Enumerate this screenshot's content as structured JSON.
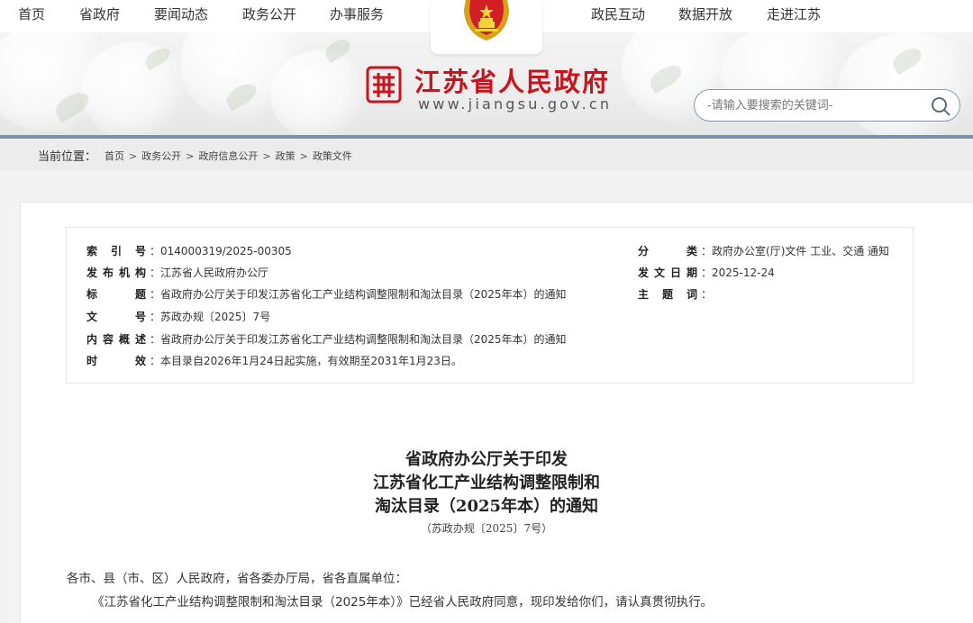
{
  "nav": {
    "items": [
      "首页",
      "省政府",
      "要闻动态",
      "政务公开",
      "办事服务",
      "政民互动",
      "数据开放",
      "走进江苏"
    ]
  },
  "header": {
    "title": "江苏省人民政府",
    "url": "www.jiangsu.gov.cn",
    "logo_icon": "jiangsu-gov-logo-icon",
    "emblem_icon": "national-emblem-icon",
    "brand_color": "#c8151d"
  },
  "search": {
    "placeholder": "-请输入要搜索的关键词-",
    "icon": "search-icon"
  },
  "breadcrumb": {
    "label": "当前位置：",
    "items": [
      "首页",
      "政务公开",
      "政府信息公开",
      "政策",
      "政策文件"
    ]
  },
  "meta": {
    "left": [
      {
        "key": "索引号",
        "value": "014000319/2025-00305"
      },
      {
        "key": "发布机构",
        "value": "江苏省人民政府办公厅"
      },
      {
        "key": "标题",
        "value": "省政府办公厅关于印发江苏省化工产业结构调整限制和淘汰目录（2025年本）的通知"
      },
      {
        "key": "文号",
        "value": "苏政办规〔2025〕7号"
      },
      {
        "key": "内容概述",
        "value": "省政府办公厅关于印发江苏省化工产业结构调整限制和淘汰目录（2025年本）的通知"
      },
      {
        "key": "时效",
        "value": "本目录自2026年1月24日起实施，有效期至2031年1月23日。"
      }
    ],
    "right": [
      {
        "key": "分类",
        "value": "政府办公室(厅)文件 工业、交通 通知"
      },
      {
        "key": "发文日期",
        "value": "2025-12-24"
      },
      {
        "key": "主题词",
        "value": ""
      }
    ]
  },
  "article": {
    "title_lines": [
      "省政府办公厅关于印发",
      "江苏省化工产业结构调整限制和",
      "淘汰目录（2025年本）的通知"
    ],
    "doc_no": "（苏政办规〔2025〕7号）",
    "salutation": "各市、县（市、区）人民政府，省各委办厅局，省各直属单位：",
    "body": "《江苏省化工产业结构调整限制和淘汰目录（2025年本）》已经省人民政府同意，现印发给你们，请认真贯彻执行。"
  }
}
